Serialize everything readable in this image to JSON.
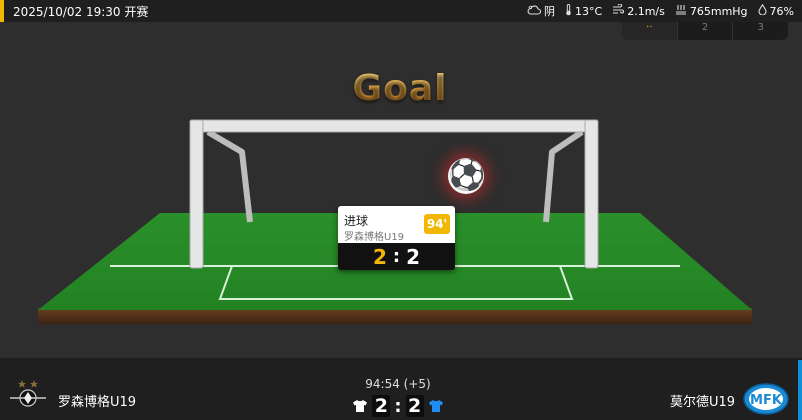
{
  "header": {
    "match_time": "2025/10/02 19:30 开赛",
    "weather": {
      "condition": "阴",
      "condition_icon": "cloudy-icon",
      "temperature": "13°C",
      "wind": "2.1m/s",
      "pressure": "765mmHg",
      "humidity": "76%"
    }
  },
  "tabs": [
    {
      "label": "··"
    },
    {
      "label": "2"
    },
    {
      "label": "3"
    }
  ],
  "stage": {
    "title": "Goal"
  },
  "event_card": {
    "type": "进球",
    "team": "罗森博格U19",
    "minute": "94'",
    "score_home": "2",
    "score_sep": ":",
    "score_away": "2"
  },
  "match": {
    "home_team": "罗森博格U19",
    "away_team": "莫尔德U19",
    "clock": "94:54 (+5)",
    "home_score": "2",
    "score_sep": ":",
    "away_score": "2",
    "away_logo_text": "MFK"
  },
  "colors": {
    "accent": "#f2b705",
    "away_accent": "#0f8fd6",
    "home_shirt": "#ffffff",
    "away_shirt": "#1e8ff0"
  }
}
